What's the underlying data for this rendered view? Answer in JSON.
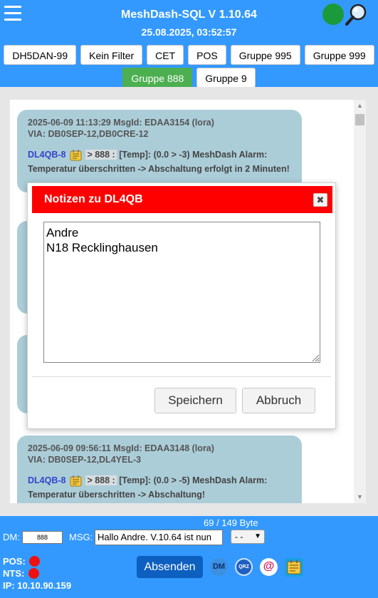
{
  "header": {
    "title": "MeshDash-SQL V 1.10.64",
    "datetime": "25.08.2025, 03:52:57"
  },
  "filters": [
    {
      "label": "DH5DAN-99",
      "active": false
    },
    {
      "label": "Kein Filter",
      "active": false
    },
    {
      "label": "CET",
      "active": false
    },
    {
      "label": "POS",
      "active": false
    },
    {
      "label": "Gruppe 995",
      "active": false
    },
    {
      "label": "Gruppe 999",
      "active": false
    },
    {
      "label": "Gruppe 888",
      "active": true
    },
    {
      "label": "Gruppe 9",
      "active": false
    }
  ],
  "messages": [
    {
      "meta1": "2025-06-09 11:13:29 MsgId: EDAA3154 (lora)",
      "meta2": "VIA: DB0SEP-12,DB0CRE-12",
      "callsign": "DL4QB-8",
      "group": "> 888 :",
      "text": "[Temp]: (0.0 > -3) MeshDash Alarm: Temperatur überschritten -> Abschaltung erfolgt in 2 Minuten!"
    },
    {
      "meta1": "2025-06-09 09:56:11 MsgId: EDAA3148 (lora)",
      "meta2": "VIA: DB0SEP-12,DL4YEL-3",
      "callsign": "DL4QB-8",
      "group": "> 888 :",
      "text": "[Temp]: (0.0 > -5) MeshDash Alarm: Temperatur überschritten -> Abschaltung!"
    }
  ],
  "dialog": {
    "title": "Notizen zu DL4QB",
    "close_label": "✖",
    "notes": "Andre\nN18 Recklinghausen",
    "save_label": "Speichern",
    "cancel_label": "Abbruch"
  },
  "footer": {
    "byte_count": "69 / 149 Byte",
    "dm_label": "DM:",
    "dm_value": "888",
    "msg_label": "MSG:",
    "msg_value": "Hallo Andre. V.10.64 ist nun",
    "select_value": "- -",
    "pos_label": "POS:",
    "nts_label": "NTS:",
    "ip_label": "IP: 10.10.90.159",
    "send_label": "Absenden",
    "dm_icon_label": "DM",
    "qrz_icon_label": "QRZ",
    "at_icon_label": "@"
  },
  "colors": {
    "background": "#3399ff",
    "status_dot": "#1a9a3a",
    "active_filter": "#4caf50",
    "dialog_title_bar": "#ff0000",
    "bubble": "#abcdd8",
    "callsign": "#3344cc",
    "send_button": "#0d5fc0",
    "red_status": "#ee1111"
  },
  "icons": [
    "hamburger-menu-icon",
    "status-indicator",
    "search-icon",
    "note-icon",
    "close-icon",
    "resize-grip-icon",
    "dm-icon",
    "qrz-icon",
    "at-icon",
    "notes-icon"
  ]
}
